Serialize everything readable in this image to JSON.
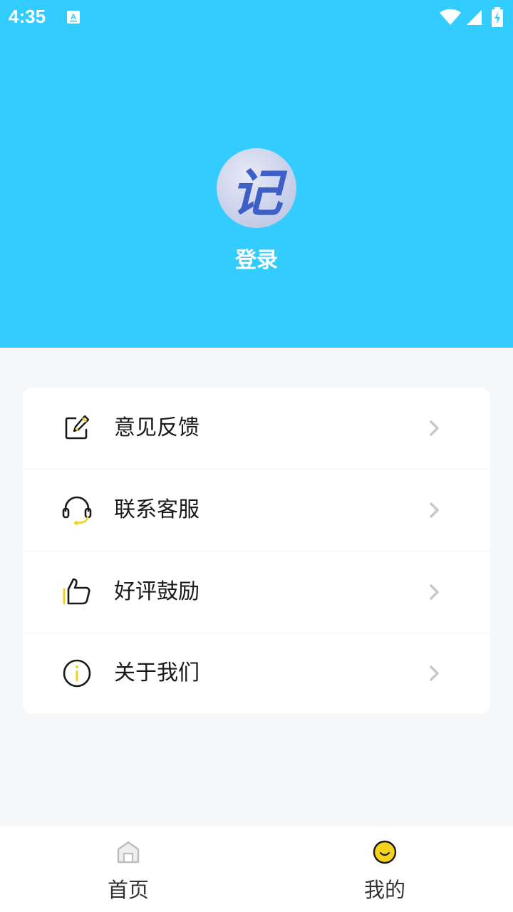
{
  "status_bar": {
    "time": "4:35",
    "icons": [
      "keyboard-a-icon",
      "wifi-icon",
      "signal-icon",
      "battery-icon"
    ]
  },
  "profile": {
    "avatar_char": "记",
    "login_label": "登录"
  },
  "menu": {
    "items": [
      {
        "label": "意见反馈",
        "icon": "edit-icon"
      },
      {
        "label": "联系客服",
        "icon": "headset-icon"
      },
      {
        "label": "好评鼓励",
        "icon": "thumbs-up-icon"
      },
      {
        "label": "关于我们",
        "icon": "info-icon"
      }
    ]
  },
  "tabs": [
    {
      "label": "首页",
      "icon": "home-icon",
      "active": false
    },
    {
      "label": "我的",
      "icon": "smile-icon",
      "active": true
    }
  ],
  "colors": {
    "header_bg": "#33ccff",
    "accent_yellow": "#f5d21c",
    "page_bg": "#f6f7f9"
  }
}
